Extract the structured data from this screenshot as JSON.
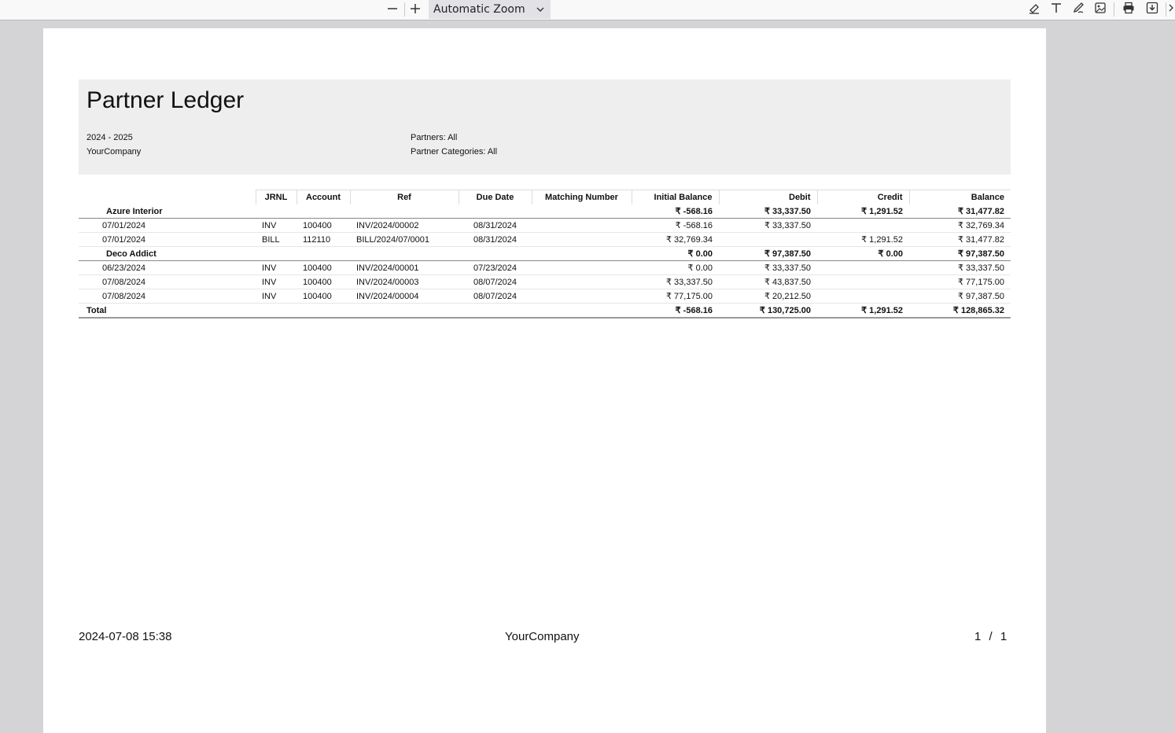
{
  "viewer": {
    "zoom_label": "Automatic Zoom",
    "icons": [
      "zoom-out-icon",
      "zoom-in-icon",
      "chevron-down-icon",
      "highlight-icon",
      "text-icon",
      "draw-icon",
      "image-icon",
      "print-icon",
      "download-icon"
    ]
  },
  "report": {
    "title": "Partner Ledger",
    "period": "2024 - 2025",
    "company": "YourCompany",
    "partners_filter": "Partners: All",
    "categories_filter": "Partner Categories: All"
  },
  "table": {
    "headers": {
      "jrnl": "JRNL",
      "account": "Account",
      "ref": "Ref",
      "due_date": "Due Date",
      "matching": "Matching Number",
      "initial": "Initial Balance",
      "debit": "Debit",
      "credit": "Credit",
      "balance": "Balance"
    },
    "groups": [
      {
        "partner": "Azure Interior",
        "initial": "₹ -568.16",
        "debit": "₹ 33,337.50",
        "credit": "₹ 1,291.52",
        "balance": "₹ 31,477.82",
        "lines": [
          {
            "date": "07/01/2024",
            "jrnl": "INV",
            "account": "100400",
            "ref": "INV/2024/00002",
            "due": "08/31/2024",
            "matching": "",
            "initial": "₹ -568.16",
            "debit": "₹ 33,337.50",
            "credit": "",
            "balance": "₹ 32,769.34"
          },
          {
            "date": "07/01/2024",
            "jrnl": "BILL",
            "account": "112110",
            "ref": "BILL/2024/07/0001",
            "due": "08/31/2024",
            "matching": "",
            "initial": "₹ 32,769.34",
            "debit": "",
            "credit": "₹ 1,291.52",
            "balance": "₹ 31,477.82"
          }
        ]
      },
      {
        "partner": "Deco Addict",
        "initial": "₹ 0.00",
        "debit": "₹ 97,387.50",
        "credit": "₹ 0.00",
        "balance": "₹ 97,387.50",
        "lines": [
          {
            "date": "06/23/2024",
            "jrnl": "INV",
            "account": "100400",
            "ref": "INV/2024/00001",
            "due": "07/23/2024",
            "matching": "",
            "initial": "₹ 0.00",
            "debit": "₹ 33,337.50",
            "credit": "",
            "balance": "₹ 33,337.50"
          },
          {
            "date": "07/08/2024",
            "jrnl": "INV",
            "account": "100400",
            "ref": "INV/2024/00003",
            "due": "08/07/2024",
            "matching": "",
            "initial": "₹ 33,337.50",
            "debit": "₹ 43,837.50",
            "credit": "",
            "balance": "₹ 77,175.00"
          },
          {
            "date": "07/08/2024",
            "jrnl": "INV",
            "account": "100400",
            "ref": "INV/2024/00004",
            "due": "08/07/2024",
            "matching": "",
            "initial": "₹ 77,175.00",
            "debit": "₹ 20,212.50",
            "credit": "",
            "balance": "₹ 97,387.50"
          }
        ]
      }
    ],
    "total": {
      "label": "Total",
      "initial": "₹ -568.16",
      "debit": "₹ 130,725.00",
      "credit": "₹ 1,291.52",
      "balance": "₹ 128,865.32"
    }
  },
  "footer": {
    "timestamp": "2024-07-08 15:38",
    "company": "YourCompany",
    "page_current": "1",
    "page_sep": "/",
    "page_total": "1"
  }
}
